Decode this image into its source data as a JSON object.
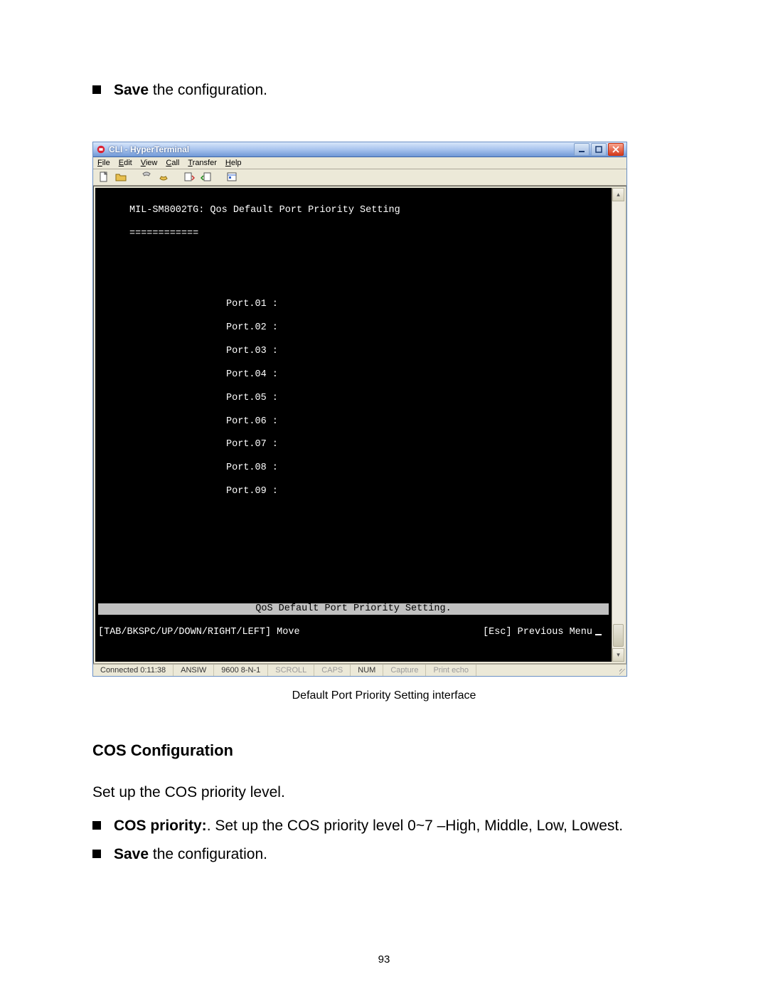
{
  "bullet_top": {
    "strong": "Save",
    "rest": " the configuration."
  },
  "window": {
    "title": "CLI - HyperTerminal",
    "menu": [
      "File",
      "Edit",
      "View",
      "Call",
      "Transfer",
      "Help"
    ],
    "toolbar_icons": [
      "new-doc-icon",
      "open-folder-icon",
      "phone-icon",
      "hangup-icon",
      "send-icon",
      "receive-icon",
      "properties-icon"
    ],
    "terminal": {
      "heading": "MIL-SM8002TG: Qos Default Port Priority Setting",
      "rule": "============",
      "ports": [
        "Port.01 :",
        "Port.02 :",
        "Port.03 :",
        "Port.04 :",
        "Port.05 :",
        "Port.06 :",
        "Port.07 :",
        "Port.08 :",
        "Port.09 :"
      ],
      "footer_bar": "QoS Default Port Priority Setting.",
      "nav_left": "[TAB/BKSPC/UP/DOWN/RIGHT/LEFT] Move",
      "nav_right": "[Esc] Previous Menu"
    },
    "status": {
      "conn": "Connected 0:11:38",
      "emu": "ANSIW",
      "port": "9600 8-N-1",
      "flags": [
        "SCROLL",
        "CAPS",
        "NUM",
        "Capture",
        "Print echo"
      ]
    }
  },
  "caption": "Default Port Priority Setting interface",
  "section_heading": "COS Configuration",
  "para_intro": "Set up the COS priority level.",
  "bullet_cos": {
    "strong": "COS priority:",
    "rest": ". Set up the COS priority level 0~7 –High, Middle, Low, Lowest."
  },
  "bullet_save2": {
    "strong": "Save",
    "rest": " the configuration."
  },
  "page_number": "93"
}
